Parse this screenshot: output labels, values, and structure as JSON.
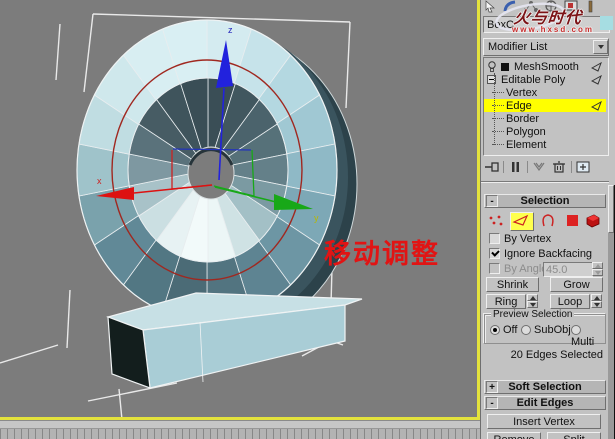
{
  "viewport": {
    "annotation": "移动调整",
    "axis": {
      "x": "x",
      "y": "y",
      "z": "z"
    },
    "colors": {
      "background": "#7c7c7c",
      "selection_wire": "#e8e8e8",
      "selected_edge_loop": "#a02820",
      "axis_x": "#dd1111",
      "axis_y": "#18a818",
      "axis_z": "#2222dd",
      "annotation_red": "#e11414",
      "active_border": "#e3e23c"
    }
  },
  "watermark": {
    "logo": "火与时代",
    "url": "www.hxsd.com"
  },
  "command_panel": {
    "object_name": "BoxC",
    "modifier_list_label": "Modifier List",
    "stack": {
      "modifiers": [
        {
          "label": "MeshSmooth"
        },
        {
          "label": "Editable Poly"
        }
      ],
      "sub_objects": [
        "Vertex",
        "Edge",
        "Border",
        "Polygon",
        "Element"
      ],
      "selected_sub_object": "Edge",
      "highlight_color": "#ffff00"
    },
    "selection": {
      "title": "Selection",
      "state": "-",
      "by_vertex": "By Vertex",
      "ignore_backfacing": "Ignore Backfacing",
      "by_angle": "By Angle",
      "by_angle_value": "45.0",
      "shrink": "Shrink",
      "grow": "Grow",
      "ring": "Ring",
      "loop": "Loop",
      "preview": {
        "title": "Preview Selection",
        "options": [
          "Off",
          "SubObj",
          "Multi"
        ],
        "selected": "Off"
      },
      "status": "20 Edges Selected"
    },
    "soft_selection": {
      "title": "Soft Selection",
      "state": "+"
    },
    "edit_edges": {
      "title": "Edit Edges",
      "state": "-",
      "buttons": [
        "Insert Vertex",
        "Remove",
        "Split"
      ]
    }
  }
}
